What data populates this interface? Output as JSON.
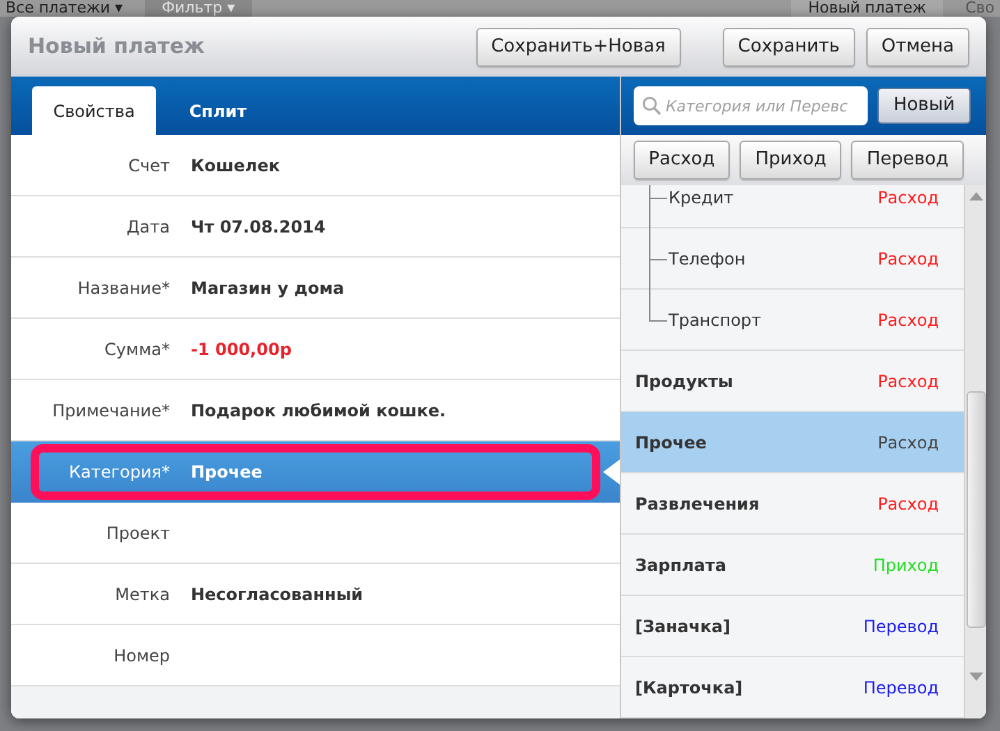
{
  "background": {
    "menu": "Все платежи ▾",
    "filter": "Фильтр ▾",
    "new_button": "Новый платеж",
    "cut_label": "Сво"
  },
  "dialog": {
    "title": "Новый платеж",
    "buttons": [
      "Сохранить+Новая",
      "Сохранить",
      "Отмена"
    ]
  },
  "tabs": [
    {
      "label": "Свойства",
      "selected": true
    },
    {
      "label": "Сплит",
      "selected": false
    }
  ],
  "form": [
    {
      "label": "Счет",
      "value": "Кошелек",
      "kind": "text",
      "selected": false
    },
    {
      "label": "Дата",
      "value": "Чт 07.08.2014",
      "kind": "text",
      "selected": false
    },
    {
      "label": "Название*",
      "value": "Магазин у дома",
      "kind": "text",
      "selected": false
    },
    {
      "label": "Сумма*",
      "value": "-1 000,00р",
      "kind": "amount",
      "selected": false
    },
    {
      "label": "Примечание*",
      "value": "Подарок любимой кошке.",
      "kind": "text",
      "selected": false
    },
    {
      "label": "Категория*",
      "value": "Прочее",
      "kind": "text",
      "selected": true
    },
    {
      "label": "Проект",
      "selected": false
    },
    {
      "label": "Метка",
      "value": "Несогласованный",
      "kind": "text",
      "selected": false
    },
    {
      "label": "Номер",
      "selected": false
    }
  ],
  "search": {
    "placeholder": "Категория или Перевс"
  },
  "new_button": "Новый",
  "type_buttons": [
    "Расход",
    "Приход",
    "Перевод"
  ],
  "categories": [
    {
      "children": [
        {
          "name": "Кредит",
          "type": "Расход",
          "color": "#ff1a1a",
          "selected": false
        },
        {
          "name": "Телефон",
          "type": "Расход",
          "color": "#ff1a1a",
          "selected": false
        },
        {
          "name": "Транспорт",
          "type": "Расход",
          "color": "#ff1a1a",
          "selected": false
        }
      ]
    },
    {
      "name": "Продукты",
      "type": "Расход",
      "color": "#ff1a1a",
      "selected": false
    },
    {
      "name": "Прочее",
      "type": "Расход",
      "color": "#444444",
      "selected": true
    },
    {
      "name": "Развлечения",
      "type": "Расход",
      "color": "#ff1a1a",
      "selected": false
    },
    {
      "name": "Зарплата",
      "type": "Приход",
      "color": "#22dd22",
      "selected": false
    },
    {
      "name": "[Заначка]",
      "type": "Перевод",
      "color": "#1a1aee",
      "selected": false
    },
    {
      "name": "[Карточка]",
      "type": "Перевод",
      "color": "#1a1aee",
      "selected": false
    }
  ]
}
